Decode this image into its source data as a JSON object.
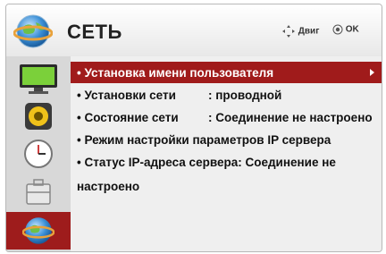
{
  "header": {
    "title": "СЕТЬ",
    "hint_move": "Двиг",
    "hint_ok": "OK"
  },
  "sidebar": {
    "items": [
      {
        "icon": "monitor-icon"
      },
      {
        "icon": "speaker-icon"
      },
      {
        "icon": "clock-icon"
      },
      {
        "icon": "toolbox-icon"
      },
      {
        "icon": "network-globe-icon",
        "active": true
      }
    ]
  },
  "menu": {
    "rows": [
      {
        "label": "• Установка имени пользователя",
        "selected": true
      },
      {
        "label": "• Установки сети",
        "value": ": проводной"
      },
      {
        "label": "• Состояние сети",
        "value": ": Соединение не настроено"
      },
      {
        "label": "• Режим настройки параметров IP сервера"
      },
      {
        "label": "• Статус IP-адреса сервера: Соединение не"
      },
      {
        "label": "настроено"
      }
    ]
  },
  "colors": {
    "accent": "#a01b1b",
    "sidebar_bg": "#d8d8d8",
    "content_bg": "#efefef"
  }
}
